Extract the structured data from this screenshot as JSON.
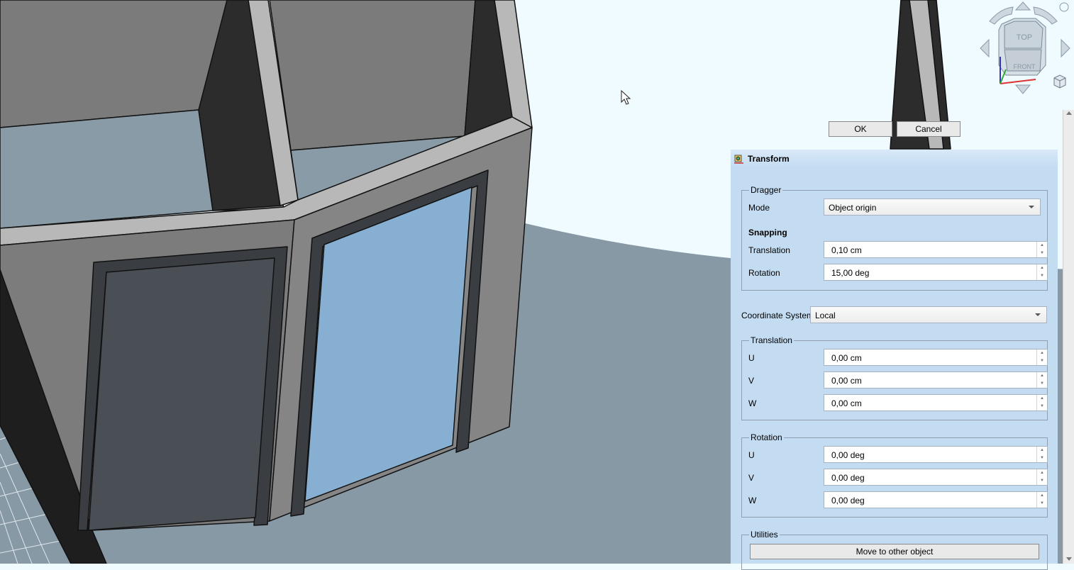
{
  "dialog_buttons": {
    "ok": "OK",
    "cancel": "Cancel"
  },
  "navcube": {
    "top": "TOP",
    "front": "FRONT"
  },
  "panel": {
    "title": "Transform",
    "dragger": {
      "group_title": "Dragger",
      "mode_label": "Mode",
      "mode_value": "Object origin",
      "snapping_heading": "Snapping",
      "translation_label": "Translation",
      "translation_value": "0,10 cm",
      "rotation_label": "Rotation",
      "rotation_value": "15,00 deg"
    },
    "coordinate_system": {
      "label": "Coordinate System",
      "value": "Local"
    },
    "translation": {
      "group_title": "Translation",
      "rows": [
        {
          "label": "U",
          "value": "0,00 cm"
        },
        {
          "label": "V",
          "value": "0,00 cm"
        },
        {
          "label": "W",
          "value": "0,00 cm"
        }
      ]
    },
    "rotation": {
      "group_title": "Rotation",
      "rows": [
        {
          "label": "U",
          "value": "0,00 deg"
        },
        {
          "label": "V",
          "value": "0,00 deg"
        },
        {
          "label": "W",
          "value": "0,00 deg"
        }
      ]
    },
    "utilities": {
      "group_title": "Utilities",
      "move_button": "Move to other object"
    }
  }
}
